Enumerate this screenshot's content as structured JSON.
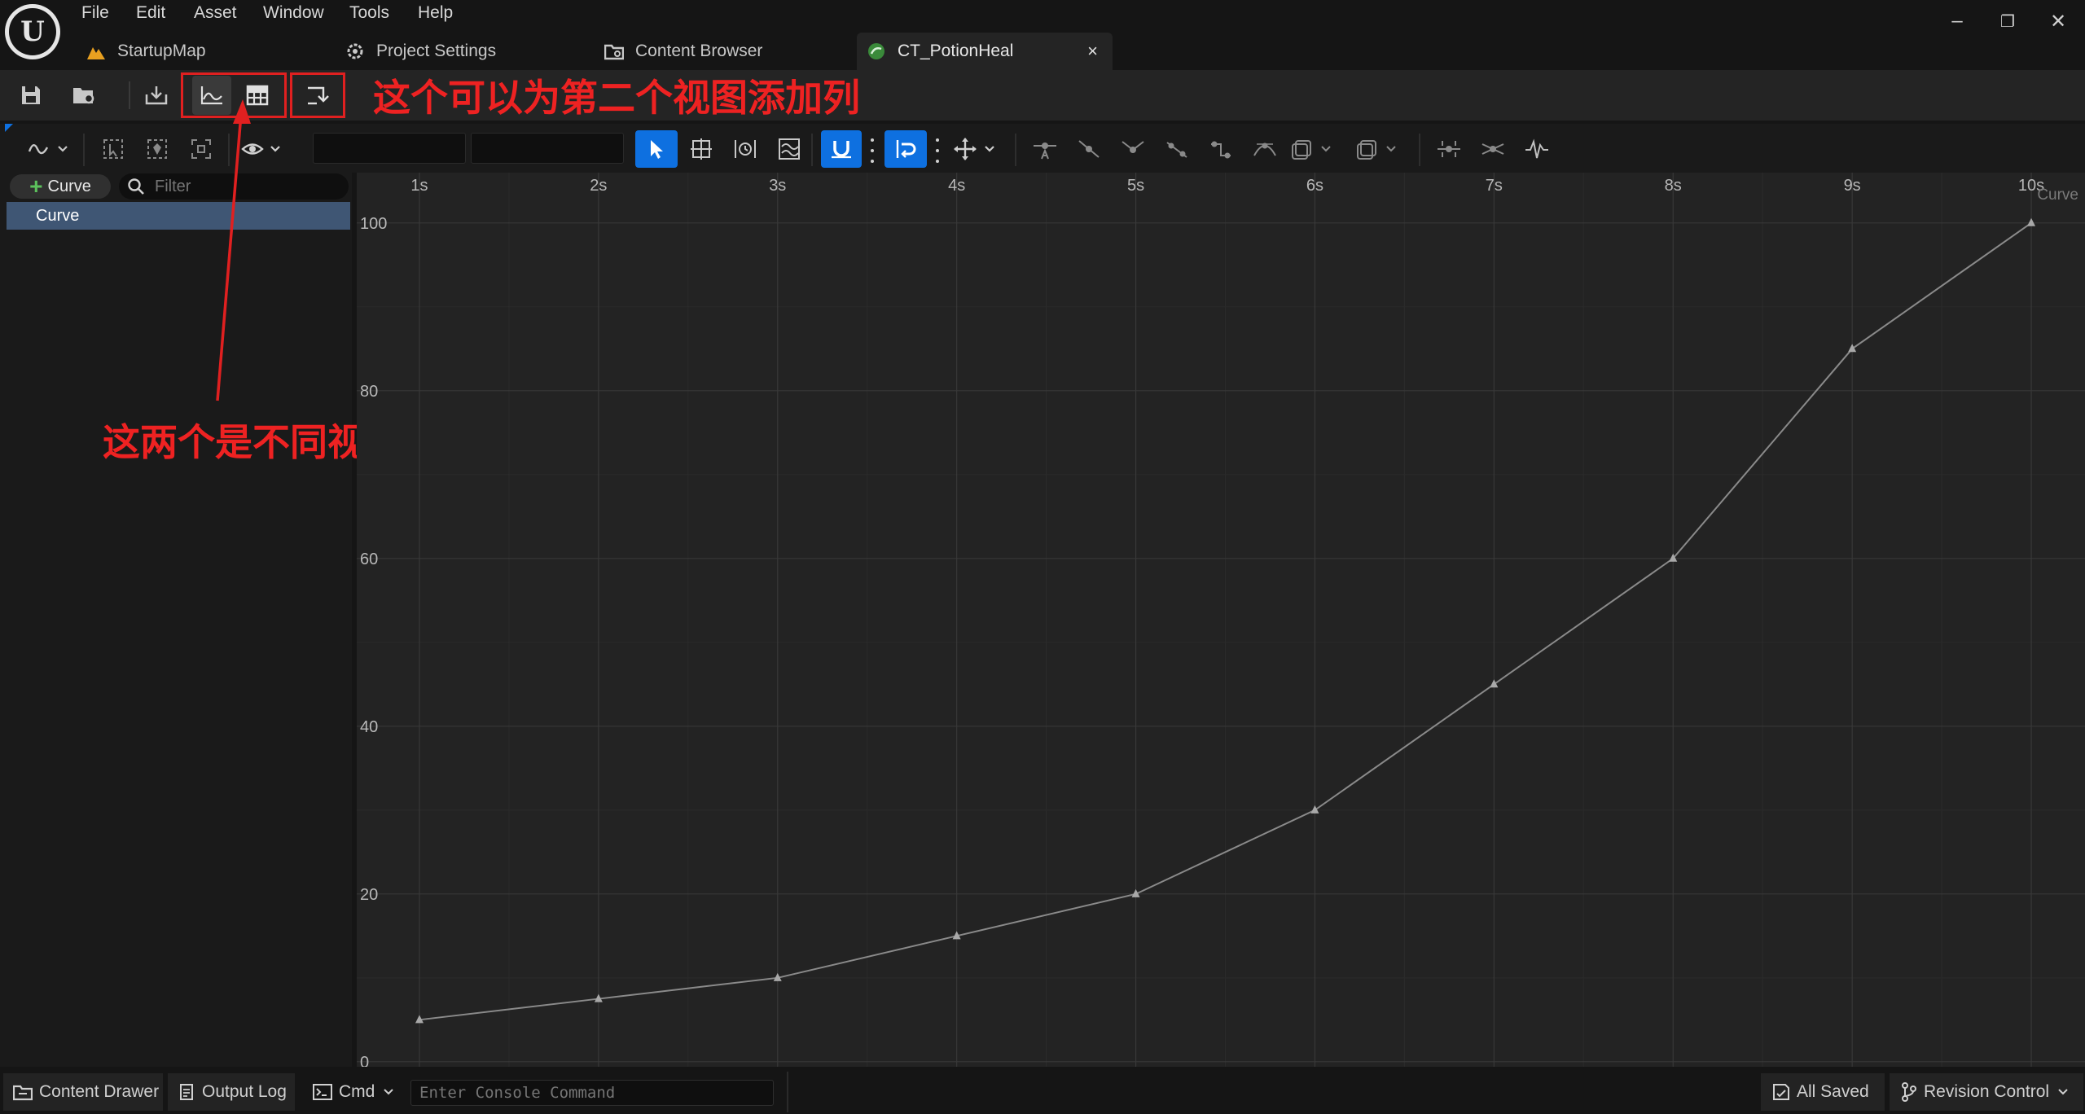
{
  "menu": [
    "File",
    "Edit",
    "Asset",
    "Window",
    "Tools",
    "Help"
  ],
  "tabs": [
    {
      "label": "StartupMap",
      "icon": "level-icon"
    },
    {
      "label": "Project Settings",
      "icon": "settings-icon"
    },
    {
      "label": "Content Browser",
      "icon": "folder-icon"
    },
    {
      "label": "CT_PotionHeal",
      "icon": "curve-table-icon",
      "active": true
    }
  ],
  "tab_close": "×",
  "window_controls": {
    "minimize": "–",
    "restore": "❐",
    "close": "✕"
  },
  "annotations": {
    "top": "这个可以为第二个视图添加列",
    "middle": "这两个是不同视图的切换"
  },
  "left_panel": {
    "add_curve_label": "Curve",
    "filter_placeholder": "Filter",
    "curves": [
      "Curve"
    ]
  },
  "colors": {
    "accent_blue": "#0e70e0",
    "selection_row": "#3f5674",
    "annotation_red": "#e02020",
    "curve_line": "#8a8a8a"
  },
  "chart_data": {
    "type": "line",
    "title": "",
    "xlabel": "",
    "ylabel": "",
    "series": [
      {
        "name": "Curve",
        "x": [
          1,
          2,
          3,
          4,
          5,
          6,
          7,
          8,
          9,
          10
        ],
        "values": [
          5,
          7.5,
          10,
          15,
          20,
          30,
          45,
          60,
          85,
          100
        ]
      }
    ],
    "x_ticks": [
      "1s",
      "2s",
      "3s",
      "4s",
      "5s",
      "6s",
      "7s",
      "8s",
      "9s",
      "10s"
    ],
    "y_ticks": [
      0,
      20,
      40,
      60,
      80,
      100
    ],
    "xlim": [
      0.65,
      10.3
    ],
    "ylim": [
      -0.6,
      106
    ],
    "grid": true,
    "series_label": "Curve"
  },
  "status_bar": {
    "content_drawer": "Content Drawer",
    "output_log": "Output Log",
    "cmd": "Cmd",
    "console_placeholder": "Enter Console Command",
    "all_saved": "All Saved",
    "revision_control": "Revision Control"
  }
}
